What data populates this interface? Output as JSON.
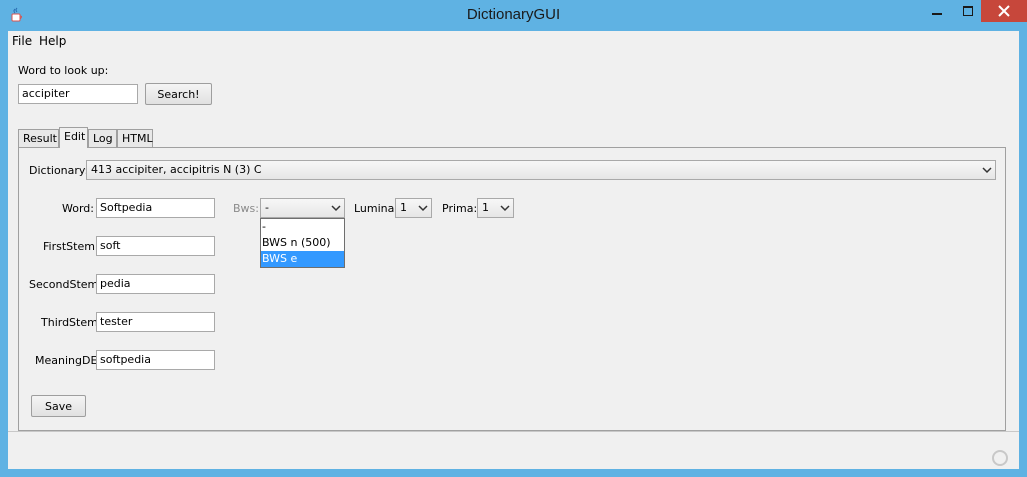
{
  "window": {
    "title": "DictionaryGUI",
    "colors": {
      "frame": "#5fb2e3",
      "close": "#c7473b",
      "selection": "#3399ff"
    }
  },
  "menu": {
    "file": "File",
    "help": "Help"
  },
  "search": {
    "label": "Word to look up:",
    "value": "accipiter",
    "button": "Search!"
  },
  "tabs": [
    {
      "label": "Result",
      "active": false
    },
    {
      "label": "Edit",
      "active": true
    },
    {
      "label": "Log",
      "active": false
    },
    {
      "label": "HTML",
      "active": false
    }
  ],
  "edit": {
    "dictionary_label": "Dictionary:",
    "dictionary_value": "413 accipiter, accipitris N (3) C",
    "fields": {
      "word": {
        "label": "Word:",
        "value": "Softpedia"
      },
      "first_stem": {
        "label": "FirstStem:",
        "value": "soft"
      },
      "second_stem": {
        "label": "SecondStem:",
        "value": "pedia"
      },
      "third_stem": {
        "label": "ThirdStem:",
        "value": "tester"
      },
      "meaning_de": {
        "label": "MeaningDE:",
        "value": "softpedia"
      }
    },
    "bws": {
      "label": "Bws:",
      "value": "-",
      "options": [
        "-",
        "BWS n (500)",
        "BWS e"
      ],
      "highlighted": "BWS e"
    },
    "lumina": {
      "label": "Lumina:",
      "value": "1"
    },
    "prima": {
      "label": "Prima:",
      "value": "1"
    },
    "save_button": "Save"
  },
  "icons": {
    "app": "java-cup-icon",
    "minimize": "minimize-icon",
    "maximize": "maximize-icon",
    "close": "close-icon",
    "dropdown": "chevron-down-icon",
    "status": "busy-indicator-icon"
  }
}
